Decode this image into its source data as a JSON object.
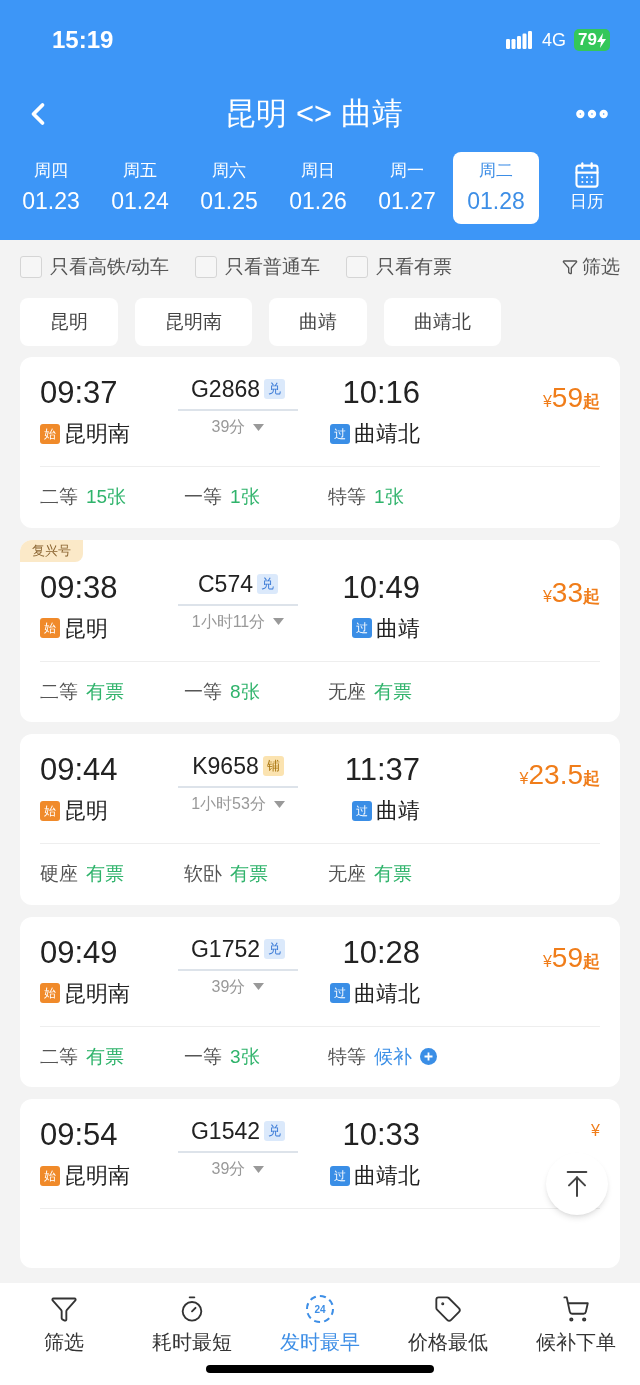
{
  "status_bar": {
    "time": "15:19",
    "network": "4G",
    "battery": "79"
  },
  "header": {
    "title": "昆明 <> 曲靖"
  },
  "dates": [
    {
      "weekday": "周四",
      "date": "01.23",
      "selected": false
    },
    {
      "weekday": "周五",
      "date": "01.24",
      "selected": false
    },
    {
      "weekday": "周六",
      "date": "01.25",
      "selected": false
    },
    {
      "weekday": "周日",
      "date": "01.26",
      "selected": false
    },
    {
      "weekday": "周一",
      "date": "01.27",
      "selected": false
    },
    {
      "weekday": "周二",
      "date": "01.28",
      "selected": true
    }
  ],
  "calendar_label": "日历",
  "filters": [
    {
      "label": "只看高铁/动车",
      "checked": false
    },
    {
      "label": "只看普通车",
      "checked": false
    },
    {
      "label": "只看有票",
      "checked": false
    }
  ],
  "filter_button": "筛选",
  "stations": [
    "昆明",
    "昆明南",
    "曲靖",
    "曲靖北"
  ],
  "trains": [
    {
      "depart": "09:37",
      "number": "G2868",
      "tag": {
        "text": "兑",
        "kind": "exchange"
      },
      "from_mark": "始",
      "from": "昆明南",
      "duration": "39分",
      "arrive": "10:16",
      "to_mark": "过",
      "to": "曲靖北",
      "price_symbol": "¥",
      "price": "59",
      "price_suffix": "起",
      "seats": [
        {
          "class": "二等",
          "value": "15张",
          "kind": "available"
        },
        {
          "class": "一等",
          "value": "1张",
          "kind": "available"
        },
        {
          "class": "特等",
          "value": "1张",
          "kind": "available"
        }
      ]
    },
    {
      "badge": "复兴号",
      "depart": "09:38",
      "number": "C574",
      "tag": {
        "text": "兑",
        "kind": "exchange"
      },
      "from_mark": "始",
      "from": "昆明",
      "duration": "1小时11分",
      "arrive": "10:49",
      "to_mark": "过",
      "to": "曲靖",
      "price_symbol": "¥",
      "price": "33",
      "price_suffix": "起",
      "seats": [
        {
          "class": "二等",
          "value": "有票",
          "kind": "available"
        },
        {
          "class": "一等",
          "value": "8张",
          "kind": "available"
        },
        {
          "class": "无座",
          "value": "有票",
          "kind": "available"
        }
      ]
    },
    {
      "depart": "09:44",
      "number": "K9658",
      "tag": {
        "text": "铺",
        "kind": "sleeper"
      },
      "from_mark": "始",
      "from": "昆明",
      "duration": "1小时53分",
      "arrive": "11:37",
      "to_mark": "过",
      "to": "曲靖",
      "price_symbol": "¥",
      "price": "23.5",
      "price_suffix": "起",
      "seats": [
        {
          "class": "硬座",
          "value": "有票",
          "kind": "available"
        },
        {
          "class": "软卧",
          "value": "有票",
          "kind": "available"
        },
        {
          "class": "无座",
          "value": "有票",
          "kind": "available"
        }
      ]
    },
    {
      "depart": "09:49",
      "number": "G1752",
      "tag": {
        "text": "兑",
        "kind": "exchange"
      },
      "from_mark": "始",
      "from": "昆明南",
      "duration": "39分",
      "arrive": "10:28",
      "to_mark": "过",
      "to": "曲靖北",
      "price_symbol": "¥",
      "price": "59",
      "price_suffix": "起",
      "seats": [
        {
          "class": "二等",
          "value": "有票",
          "kind": "available"
        },
        {
          "class": "一等",
          "value": "3张",
          "kind": "available"
        },
        {
          "class": "特等",
          "value": "候补",
          "kind": "waitlist"
        }
      ]
    },
    {
      "depart": "09:54",
      "number": "G1542",
      "tag": {
        "text": "兑",
        "kind": "exchange"
      },
      "from_mark": "始",
      "from": "昆明南",
      "duration": "39分",
      "arrive": "10:33",
      "to_mark": "过",
      "to": "曲靖北",
      "price_symbol": "¥"
    }
  ],
  "bottom_tabs": [
    {
      "label": "筛选",
      "selected": false
    },
    {
      "label": "耗时最短",
      "selected": false
    },
    {
      "label": "发时最早",
      "icon_text": "24",
      "selected": true
    },
    {
      "label": "价格最低",
      "selected": false
    },
    {
      "label": "候补下单",
      "selected": false
    }
  ]
}
